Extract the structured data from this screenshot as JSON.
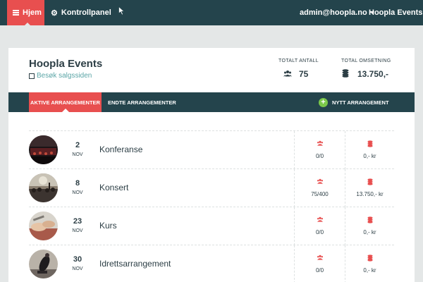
{
  "nav": {
    "home_label": "Hjem",
    "control_panel_label": "Kontrollpanel",
    "user_email": "admin@hoopla.no",
    "brand": "Hoopla Events"
  },
  "header": {
    "title": "Hoopla Events",
    "visit_link": "Besøk salgssiden",
    "total_count_label": "TOTALT ANTALL",
    "total_count_value": "75",
    "total_revenue_label": "TOTAL OMSETNING",
    "total_revenue_value": "13.750,-"
  },
  "tabs": {
    "active_label": "AKTIVE ARRANGEMENTER",
    "ended_label": "ENDTE ARRANGEMENTER",
    "new_button_label": "NYTT ARRANGEMENT"
  },
  "events": [
    {
      "day": "2",
      "month": "NOV",
      "name": "Konferanse",
      "tickets": "0/0",
      "revenue": "0,- kr"
    },
    {
      "day": "8",
      "month": "NOV",
      "name": "Konsert",
      "tickets": "75/400",
      "revenue": "13.750,- kr"
    },
    {
      "day": "23",
      "month": "NOV",
      "name": "Kurs",
      "tickets": "0/0",
      "revenue": "0,- kr"
    },
    {
      "day": "30",
      "month": "NOV",
      "name": "Idrettsarrangement",
      "tickets": "0/0",
      "revenue": "0,- kr"
    }
  ],
  "colors": {
    "navbar": "#24444c",
    "accent_red": "#e84f4f",
    "link_teal": "#5aa5a6",
    "add_green": "#7bc94a"
  },
  "icons": {
    "menu": "menu-icon",
    "settings": "gear-icon",
    "people": "people-icon",
    "money": "coins-icon",
    "external_link": "external-link-icon",
    "add": "plus-icon"
  }
}
